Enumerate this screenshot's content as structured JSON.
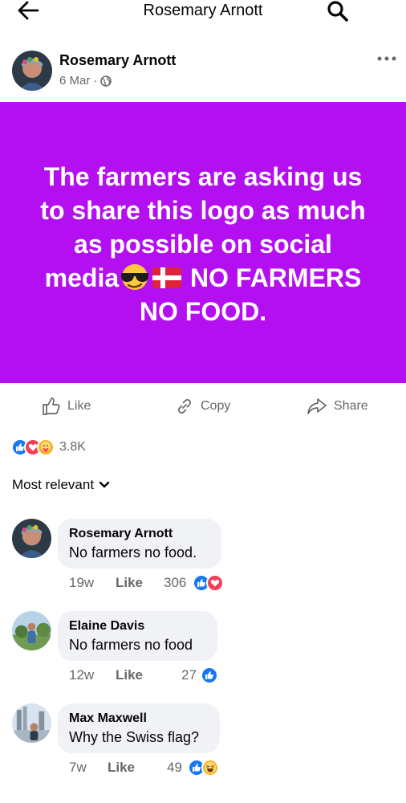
{
  "header": {
    "title": "Rosemary Arnott",
    "back_icon": "arrow-left-icon",
    "search_icon": "search-icon"
  },
  "post": {
    "author": "Rosemary Arnott",
    "date": "6 Mar",
    "separator": "·",
    "privacy_icon": "globe-icon",
    "more_icon": "more-horizontal-icon",
    "image_text_lines": [
      "The farmers are asking us",
      "to share this logo as much",
      "as possible on social",
      "NO FARMERS",
      "NO FOOD."
    ],
    "image_text_word_before_emoji": "media",
    "image_emojis": [
      "sunglasses-emoji",
      "denmark-flag-emoji"
    ],
    "background_color": "#b40ff0"
  },
  "actions": {
    "like": "Like",
    "copy": "Copy",
    "share": "Share"
  },
  "reactions": {
    "count": "3.8K",
    "types": [
      "like",
      "love",
      "care"
    ]
  },
  "sort": {
    "label": "Most relevant"
  },
  "comments": [
    {
      "name": "Rosemary Arnott",
      "text": "No farmers no food.",
      "time": "19w",
      "like_label": "Like",
      "reaction_count": "306",
      "reactions": [
        "like",
        "love"
      ]
    },
    {
      "name": "Elaine Davis",
      "text": "No farmers no food",
      "time": "12w",
      "like_label": "Like",
      "reaction_count": "27",
      "reactions": [
        "like"
      ]
    },
    {
      "name": "Max Maxwell",
      "text": "Why the Swiss flag?",
      "time": "7w",
      "like_label": "Like",
      "reaction_count": "49",
      "reactions": [
        "like",
        "haha"
      ]
    }
  ],
  "colors": {
    "accent": "#1877f2",
    "love": "#f33e58",
    "secondary_text": "#65676b",
    "bubble": "#f0f2f5"
  }
}
